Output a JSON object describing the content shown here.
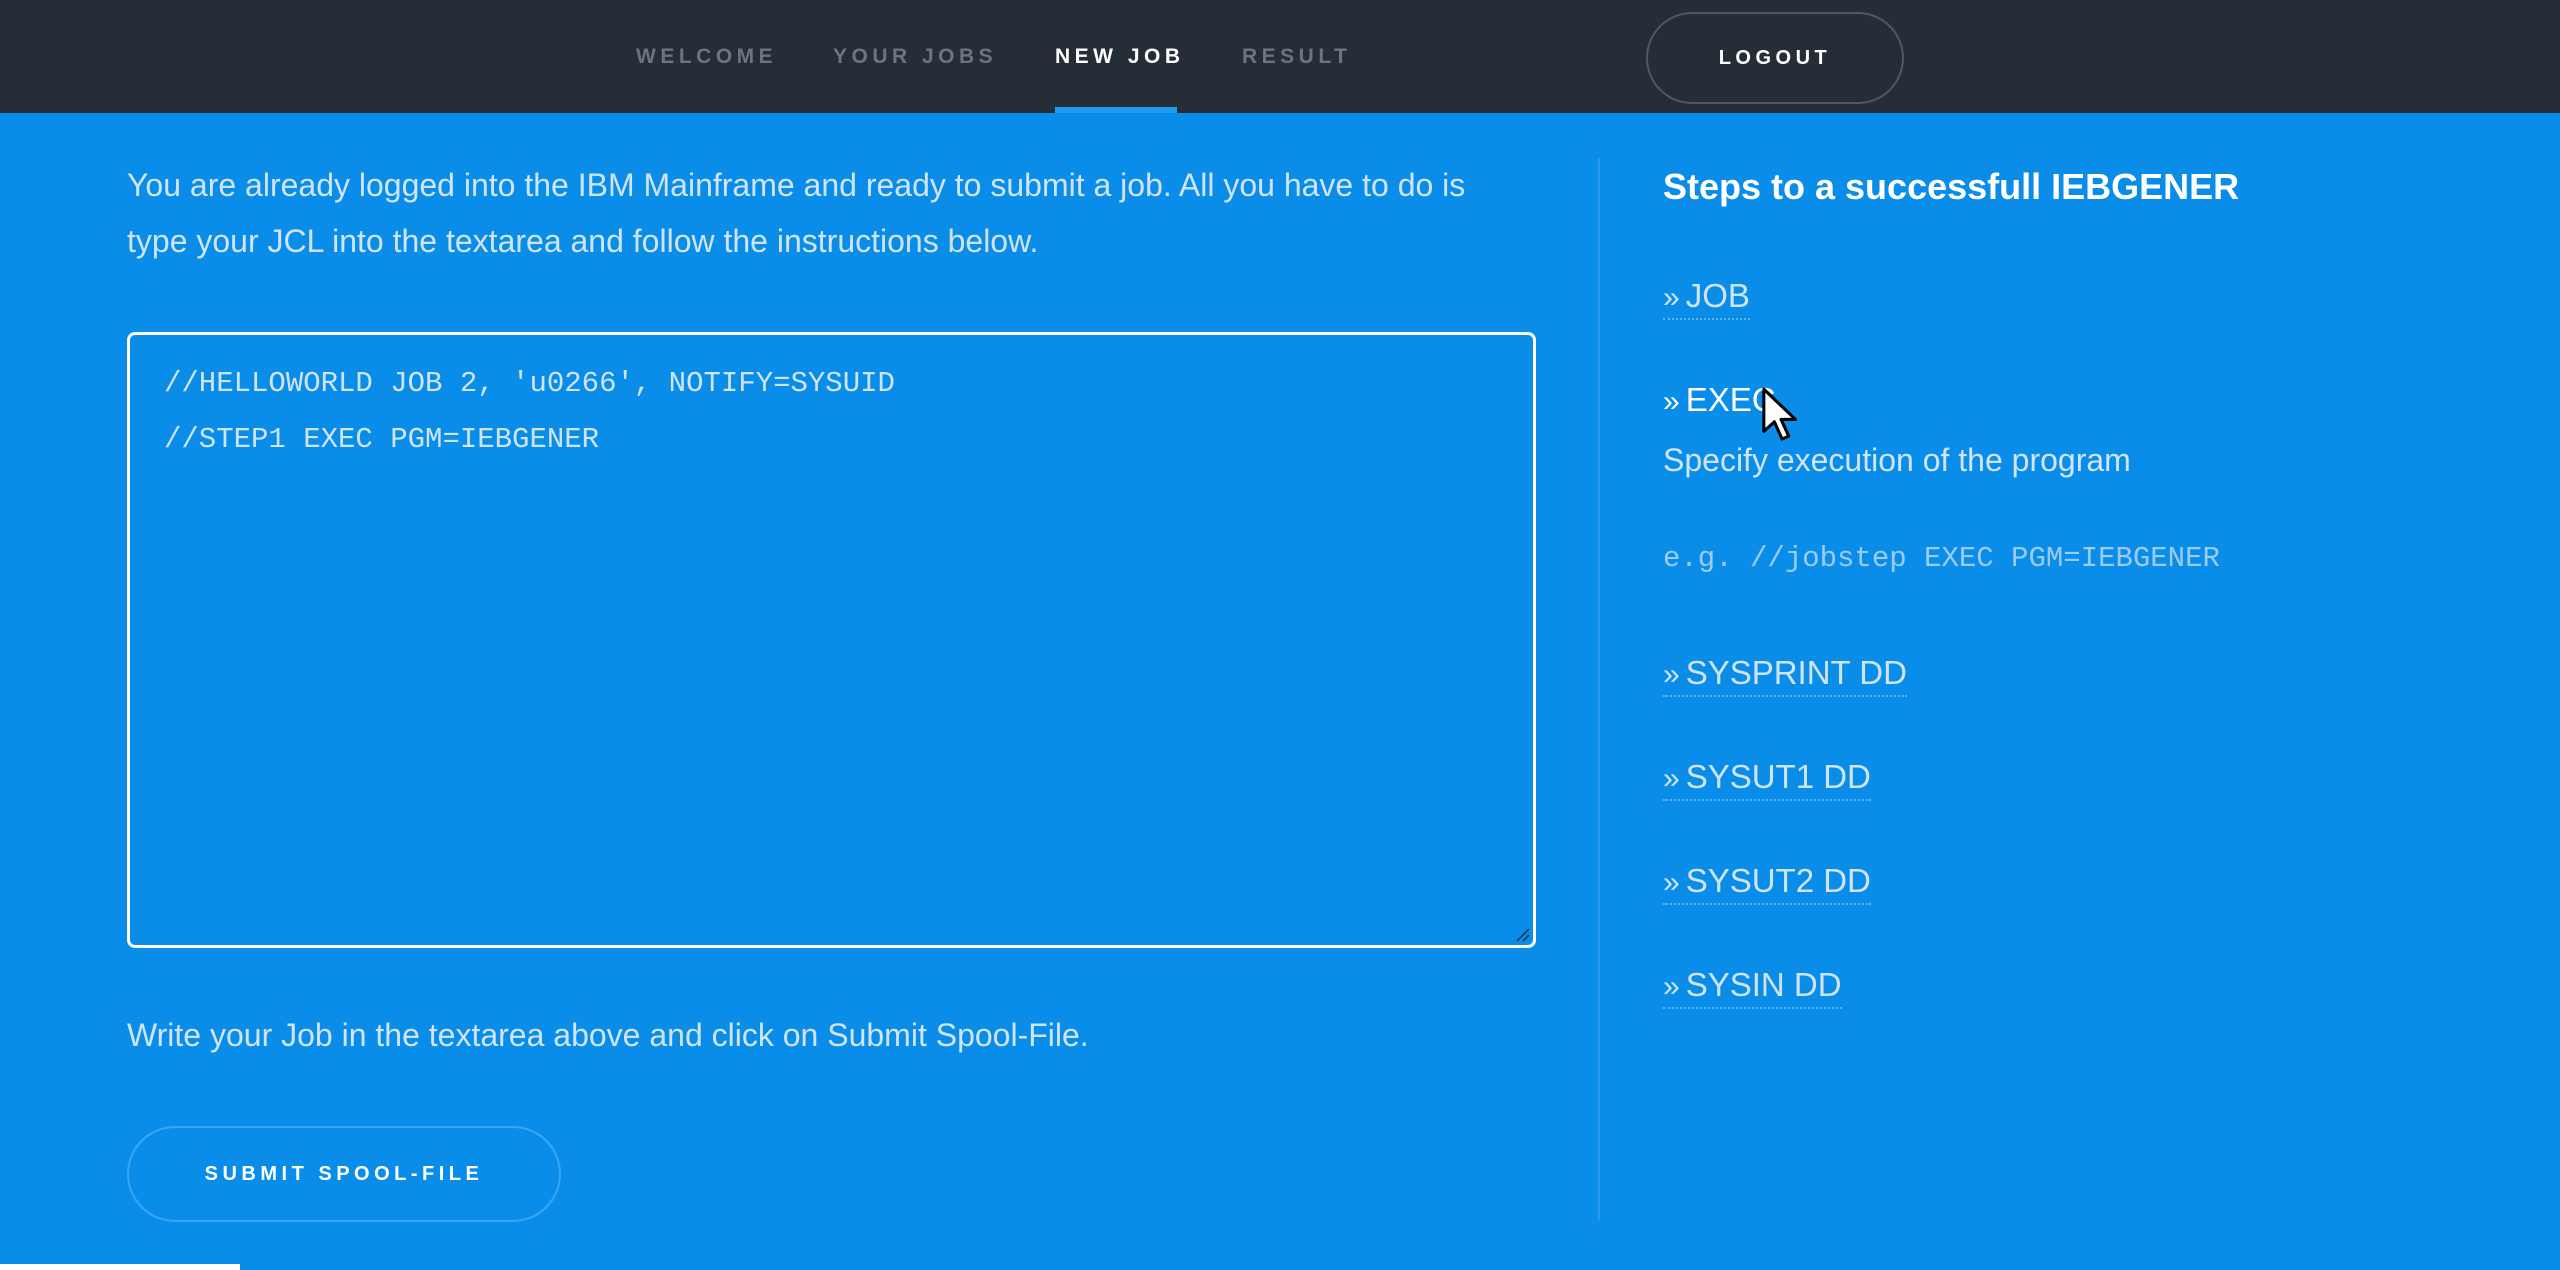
{
  "nav": {
    "items": [
      {
        "label": "WELCOME"
      },
      {
        "label": "YOUR JOBS"
      },
      {
        "label": "NEW JOB"
      },
      {
        "label": "RESULT"
      }
    ],
    "active_index": 2,
    "logout_label": "LOGOUT"
  },
  "intro_text": "You are already logged into the IBM Mainframe and ready to submit a job. All you have to do is type your JCL into the textarea and follow the instructions below.",
  "jcl_editor": {
    "lines": [
      "//HELLOWORLD JOB 2, 'u0266', NOTIFY=SYSUID",
      "//STEP1 EXEC PGM=IEBGENER"
    ]
  },
  "hint_text": "Write your Job in the textarea above and click on Submit Spool-File.",
  "submit_label": "SUBMIT SPOOL-FILE",
  "steps": {
    "title": "Steps to a successfull IEBGENER",
    "chevron": "»",
    "items": [
      {
        "label": "JOB"
      },
      {
        "label": "EXEC",
        "expanded": true,
        "description": "Specify execution of the program",
        "example": "e.g. //jobstep EXEC PGM=IEBGENER"
      },
      {
        "label": "SYSPRINT DD"
      },
      {
        "label": "SYSUT1 DD"
      },
      {
        "label": "SYSUT2 DD"
      },
      {
        "label": "SYSIN DD"
      }
    ]
  },
  "colors": {
    "page_bg": "#0a8de9",
    "topbar_bg": "#252e36",
    "nav_inactive": "#6b757d",
    "nav_active": "#ffffff",
    "text_muted": "#cfe4f6"
  },
  "icons": {
    "chevron": "double-chevron-right-icon",
    "cursor": "mouse-pointer-icon",
    "resize": "resize-grip-icon"
  }
}
